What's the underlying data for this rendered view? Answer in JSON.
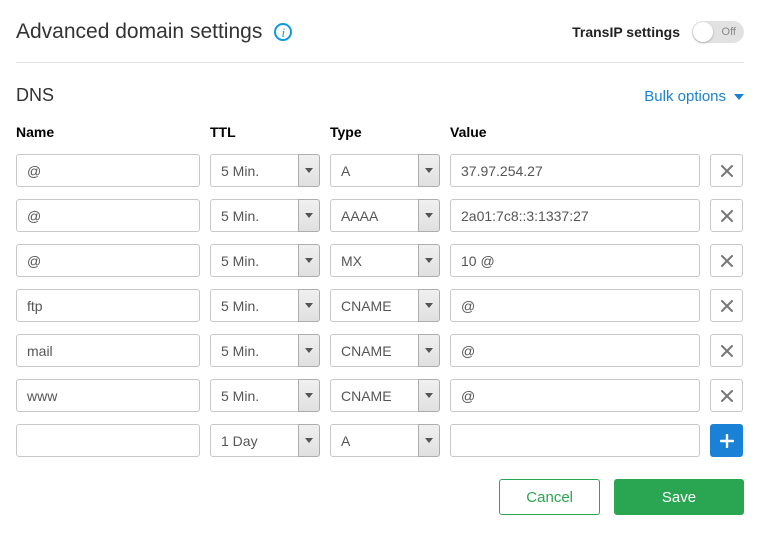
{
  "header": {
    "title": "Advanced domain settings",
    "toggle_label": "TransIP settings",
    "toggle_state": "Off"
  },
  "section": {
    "title": "DNS",
    "bulk_label": "Bulk options"
  },
  "columns": {
    "name": "Name",
    "ttl": "TTL",
    "type": "Type",
    "value": "Value"
  },
  "records": [
    {
      "name": "@",
      "ttl": "5 Min.",
      "type": "A",
      "value": "37.97.254.27"
    },
    {
      "name": "@",
      "ttl": "5 Min.",
      "type": "AAAA",
      "value": "2a01:7c8::3:1337:27"
    },
    {
      "name": "@",
      "ttl": "5 Min.",
      "type": "MX",
      "value": "10 @"
    },
    {
      "name": "ftp",
      "ttl": "5 Min.",
      "type": "CNAME",
      "value": "@"
    },
    {
      "name": "mail",
      "ttl": "5 Min.",
      "type": "CNAME",
      "value": "@"
    },
    {
      "name": "www",
      "ttl": "5 Min.",
      "type": "CNAME",
      "value": "@"
    }
  ],
  "new_record": {
    "name": "",
    "ttl": "1 Day",
    "type": "A",
    "value": ""
  },
  "footer": {
    "cancel": "Cancel",
    "save": "Save"
  }
}
